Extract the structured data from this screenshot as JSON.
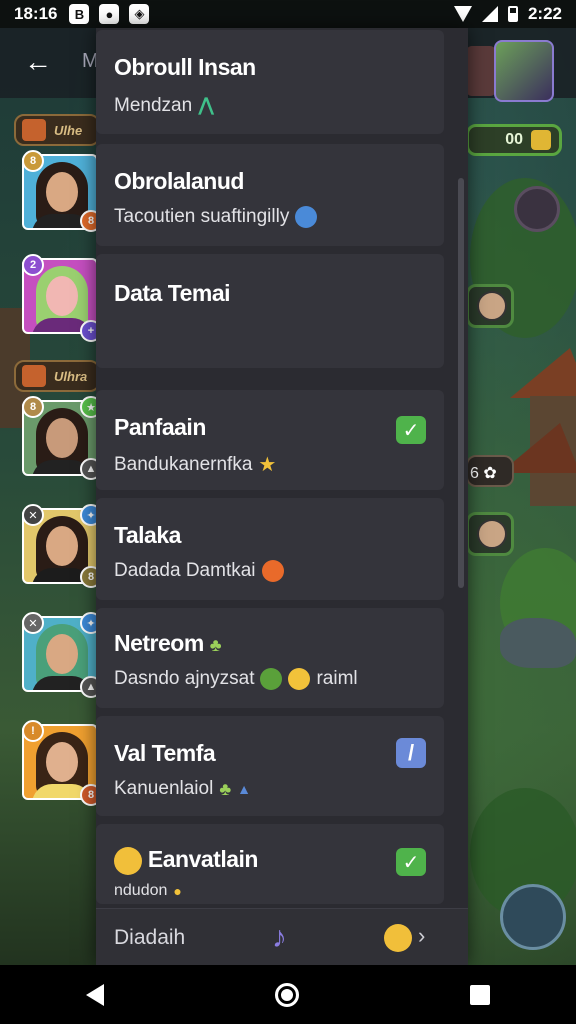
{
  "status_bar": {
    "time_left": "18:16",
    "time_right": "2:22",
    "icon_b": "B"
  },
  "background": {
    "m_letter": "M",
    "hud_count": "00",
    "chip_count": "6",
    "roster_labels": [
      "Ulhe",
      "Ulhra"
    ]
  },
  "menu": {
    "items": [
      {
        "title": "Obroull Insan",
        "sub": "Mendzan"
      },
      {
        "title": "Obrolalanud",
        "sub": "Tacoutien suaftingilly"
      },
      {
        "title": "Data Temai",
        "sub": ""
      },
      {
        "title": "Panfaain",
        "sub": "Bandukanernfka",
        "checked": true
      },
      {
        "title": "Talaka",
        "sub": "Dadada Damtkai"
      },
      {
        "title": "Netreom",
        "sub": "Dasndo ajnyzsat",
        "sub_extra": "raiml"
      },
      {
        "title": "Val Temfa",
        "sub": "Kanuenlaiol"
      },
      {
        "title": "Eanvatlain",
        "sub": "ndudon",
        "checked": true
      }
    ],
    "footer_label": "Diadaih"
  },
  "colors": {
    "panel": "#2b2b31",
    "item": "#34343b",
    "check_green": "#4fb34b",
    "accent_purple": "#8a7ce0"
  },
  "icons": {
    "back": "arrow-left-icon",
    "music": "music-note-icon",
    "chevron": "chevron-right-icon"
  }
}
